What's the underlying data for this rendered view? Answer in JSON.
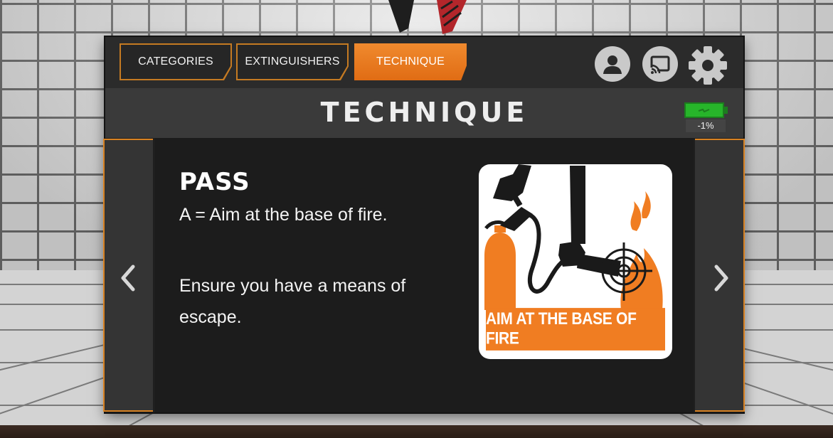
{
  "nav": {
    "tabs": [
      {
        "label": "CATEGORIES",
        "active": false
      },
      {
        "label": "EXTINGUISHERS",
        "active": false
      },
      {
        "label": "TECHNIQUE",
        "active": true
      }
    ],
    "icons": [
      "user-icon",
      "cast-icon",
      "gear-icon"
    ]
  },
  "page": {
    "title": "TECHNIQUE"
  },
  "battery": {
    "level_text": "-1%",
    "color": "#27b52a"
  },
  "content": {
    "heading": "PASS",
    "line1": "A = Aim at the base of fire.",
    "line2": "Ensure you have a means of escape."
  },
  "illustration": {
    "caption": "AIM AT THE BASE OF FIRE",
    "icon": "fire-extinguisher-aim-icon",
    "accent_color": "#f07d22"
  },
  "navigation_arrows": {
    "left_icon": "chevron-left-icon",
    "right_icon": "chevron-right-icon"
  },
  "colors": {
    "accent": "#e8771a",
    "panel": "#1f1f1f",
    "outline": "#c57a22"
  }
}
